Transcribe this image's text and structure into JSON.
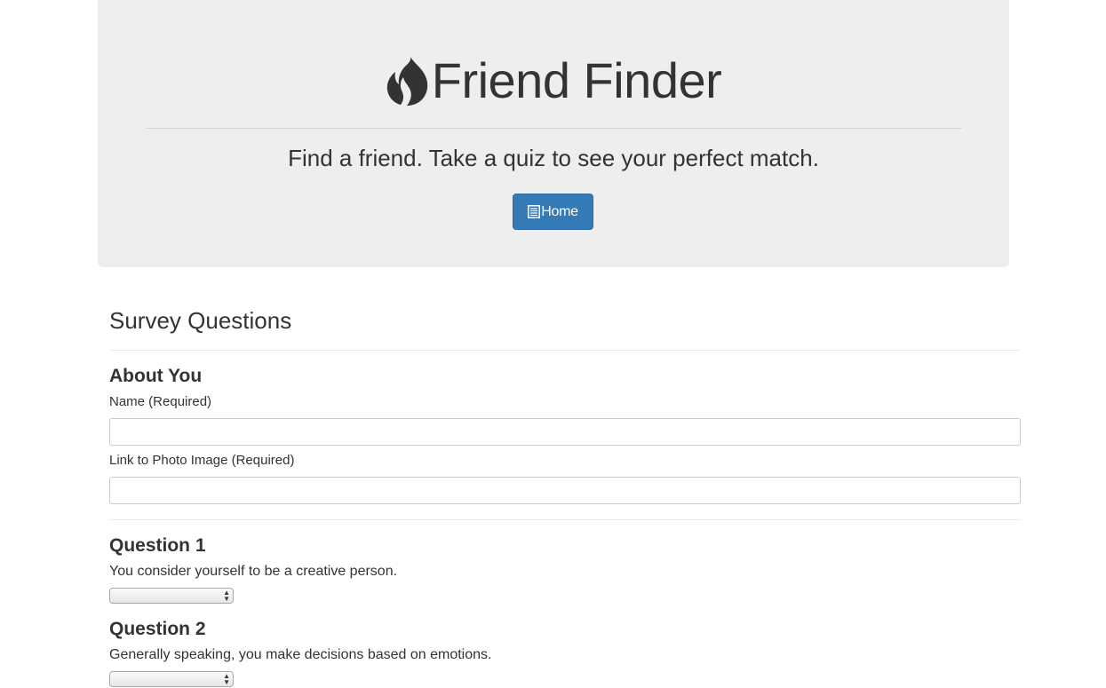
{
  "header": {
    "title": "Friend Finder",
    "tagline": "Find a friend. Take a quiz to see your perfect match.",
    "home_label": "Home",
    "icons": {
      "logo": "flame-icon",
      "home": "list-icon"
    },
    "colors": {
      "jumbotron_bg": "#eeeeee",
      "primary_button": "#337ab7"
    }
  },
  "survey": {
    "title": "Survey Questions",
    "about": {
      "heading": "About You",
      "name_label": "Name (Required)",
      "name_value": "",
      "photo_label": "Link to Photo Image (Required)",
      "photo_value": ""
    },
    "questions": [
      {
        "heading": "Question 1",
        "text": "You consider yourself to be a creative person.",
        "selected": ""
      },
      {
        "heading": "Question 2",
        "text": "Generally speaking, you make decisions based on emotions.",
        "selected": ""
      }
    ]
  }
}
